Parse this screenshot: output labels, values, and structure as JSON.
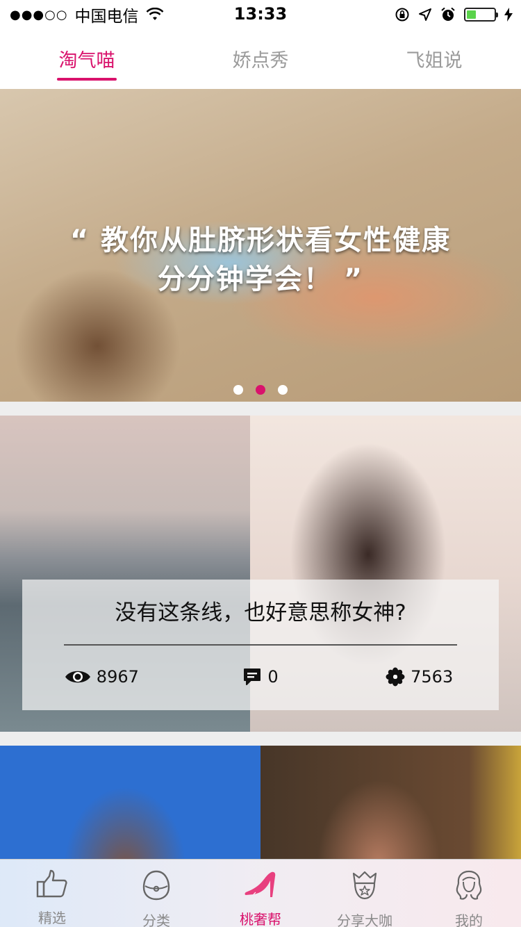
{
  "status_bar": {
    "signal": "●●●○○",
    "carrier": "中国电信",
    "time": "13:33",
    "battery_level": 0.35,
    "battery_color": "#5ad34b"
  },
  "top_tabs": [
    {
      "label": "淘气喵",
      "active": true
    },
    {
      "label": "娇点秀",
      "active": false
    },
    {
      "label": "飞姐说",
      "active": false
    }
  ],
  "banner": {
    "quote_line1": "“ 教你从肚脐形状看女性健康",
    "quote_line2": "分分钟学会！ ”",
    "page_count": 3,
    "active_index": 1
  },
  "article": {
    "title": "没有这条线，也好意思称女神?",
    "views": "8967",
    "comments": "0",
    "likes": "7563"
  },
  "bottom_tabs": [
    {
      "label": "精选",
      "icon": "thumbs-up-icon",
      "active": false
    },
    {
      "label": "分类",
      "icon": "category-icon",
      "active": false
    },
    {
      "label": "桃奢帮",
      "icon": "high-heel-icon",
      "active": true
    },
    {
      "label": "分享大咖",
      "icon": "crown-badge-icon",
      "active": false
    },
    {
      "label": "我的",
      "icon": "profile-icon",
      "active": false
    }
  ],
  "colors": {
    "accent": "#d9126c",
    "inactive": "#9b9b9b"
  }
}
